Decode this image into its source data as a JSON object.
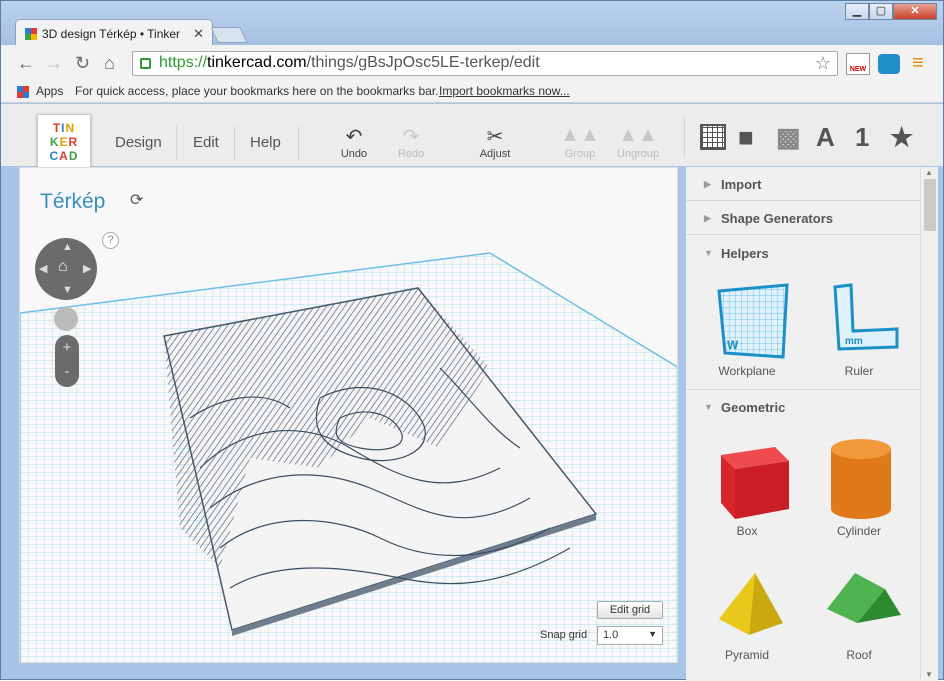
{
  "browser": {
    "tab_title": "3D design Térkép • Tinker",
    "url_scheme": "https://",
    "url_host": "tinkercad.com",
    "url_path": "/things/gBsJpOsc5LE-terkep/edit",
    "bookmarks_apps": "Apps",
    "bookmarks_hint": "For quick access, place your bookmarks here on the bookmarks bar.",
    "bookmarks_import": "Import bookmarks now...",
    "new_badge": "NEW"
  },
  "app": {
    "logo": [
      "TIN",
      "KER",
      "CAD"
    ],
    "menu": [
      "Design",
      "Edit",
      "Help"
    ],
    "tools": {
      "undo": "Undo",
      "redo": "Redo",
      "adjust": "Adjust",
      "group": "Group",
      "ungroup": "Ungroup"
    },
    "top_icons": [
      "grid-icon",
      "cube-icon",
      "hole-cube-icon",
      "A",
      "1",
      "★"
    ]
  },
  "viewport": {
    "title": "Térkép",
    "edit_grid": "Edit grid",
    "snap_label": "Snap grid",
    "snap_value": "1.0"
  },
  "panel": {
    "sections": {
      "import": "Import",
      "shape_generators": "Shape Generators",
      "helpers": "Helpers",
      "geometric": "Geometric"
    },
    "helpers": [
      "Workplane",
      "Ruler"
    ],
    "geometric": [
      "Box",
      "Cylinder",
      "Pyramid",
      "Roof"
    ],
    "colors": {
      "box": "#d8252c",
      "cylinder": "#e0791a",
      "pyramid": "#e8c81a",
      "roof": "#3a9a3a",
      "accent": "#3a8fc0",
      "grid": "#a6d8ef"
    }
  }
}
